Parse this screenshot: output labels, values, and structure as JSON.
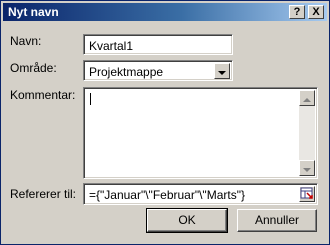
{
  "window": {
    "title": "Nyt navn",
    "help_glyph": "?",
    "close_glyph": "X"
  },
  "form": {
    "name_label": "Navn:",
    "name_value": "Kvartal1",
    "scope_label": "Område:",
    "scope_value": "Projektmappe",
    "comment_label": "Kommentar:",
    "comment_value": "",
    "refers_label": "Refererer til:",
    "refers_value": "={\"Januar\"\\\"Februar\"\\\"Marts\"}"
  },
  "buttons": {
    "ok_label": "OK",
    "cancel_label": "Annuller"
  },
  "icons": {
    "help": "help-icon",
    "close": "close-icon",
    "dropdown": "chevron-down-icon",
    "scroll_up": "scroll-up-icon",
    "scroll_down": "scroll-down-icon",
    "range_picker": "collapse-dialog-icon"
  },
  "colors": {
    "title_start": "#0a246a",
    "title_end": "#a6caf0",
    "face": "#d4d0c8"
  }
}
